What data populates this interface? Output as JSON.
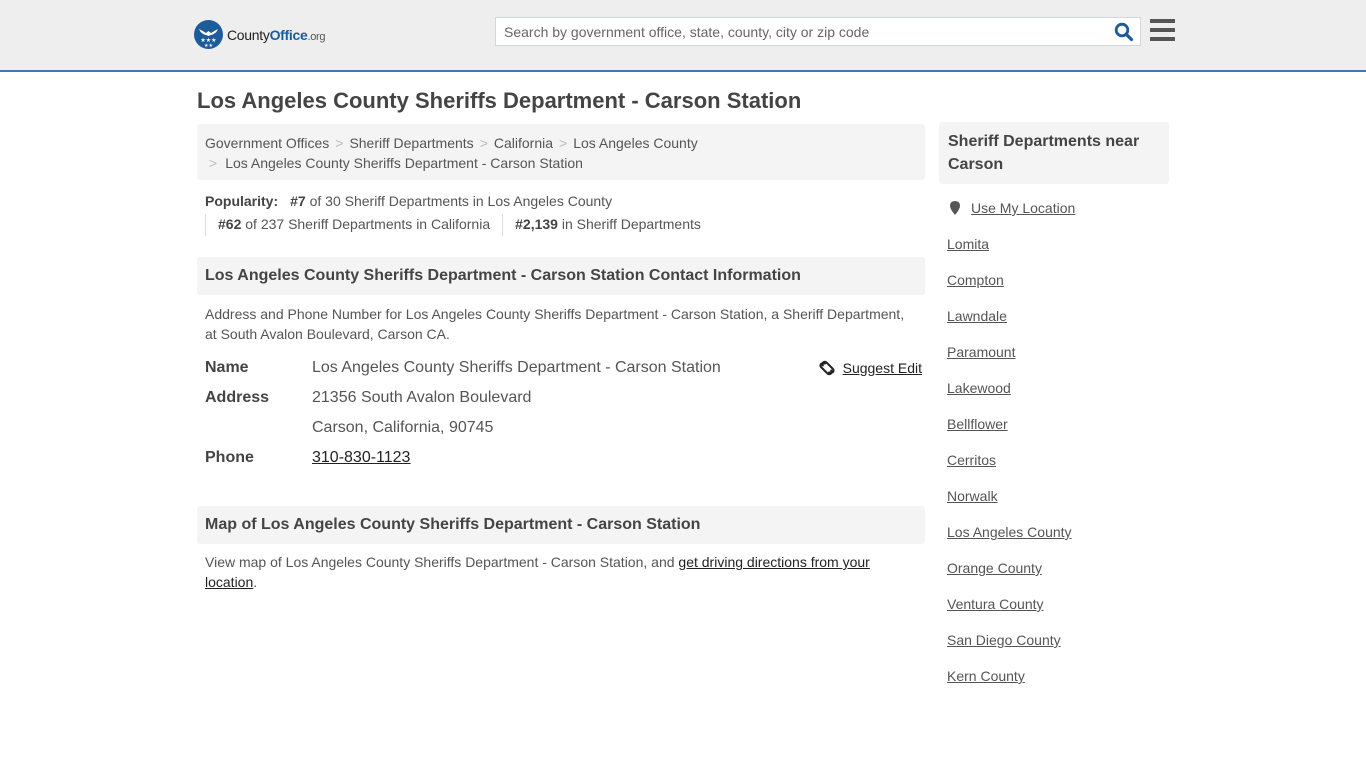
{
  "header": {
    "logo": {
      "county": "County",
      "office": "Office",
      "org": ".org",
      "icon": "eagle-stars-badge-icon"
    },
    "search": {
      "placeholder": "Search by government office, state, county, city or zip code",
      "value": "",
      "icon": "search-icon"
    },
    "menu_icon": "hamburger-menu-icon",
    "accent_color": "#1d5c9b",
    "border_color": "#3e78a8"
  },
  "page": {
    "title": "Los Angeles County Sheriffs Department - Carson Station"
  },
  "breadcrumb": [
    {
      "label": "Government Offices"
    },
    {
      "label": "Sheriff Departments"
    },
    {
      "label": "California"
    },
    {
      "label": "Los Angeles County"
    },
    {
      "label": "Los Angeles County Sheriffs Department - Carson Station"
    }
  ],
  "popularity": {
    "label": "Popularity:",
    "items": [
      {
        "rank": "#7",
        "text": " of 30 Sheriff Departments in Los Angeles County"
      },
      {
        "rank": "#62",
        "text": " of 237 Sheriff Departments in California"
      },
      {
        "rank": "#2,139",
        "text": " in Sheriff Departments"
      }
    ]
  },
  "contact": {
    "heading": "Los Angeles County Sheriffs Department - Carson Station Contact Information",
    "description": "Address and Phone Number for Los Angeles County Sheriffs Department - Carson Station, a Sheriff Department, at South Avalon Boulevard, Carson CA.",
    "suggest_edit": {
      "label": "Suggest Edit",
      "icon": "unlink-icon"
    },
    "fields": {
      "name": {
        "key": "Name",
        "value": "Los Angeles County Sheriffs Department - Carson Station"
      },
      "address": {
        "key": "Address",
        "line1": "21356 South Avalon Boulevard",
        "line2": "Carson, California, 90745"
      },
      "phone": {
        "key": "Phone",
        "value": "310-830-1123"
      }
    }
  },
  "map": {
    "heading": "Map of Los Angeles County Sheriffs Department - Carson Station",
    "text": "View map of Los Angeles County Sheriffs Department - Carson Station, and ",
    "link": "get driving directions from your location",
    "trailing": "."
  },
  "sidebar": {
    "heading": "Sheriff Departments near Carson",
    "use_location": {
      "label": "Use My Location",
      "icon": "map-pin-icon"
    },
    "links": [
      {
        "label": "Lomita"
      },
      {
        "label": "Compton"
      },
      {
        "label": "Lawndale"
      },
      {
        "label": "Paramount"
      },
      {
        "label": "Lakewood"
      },
      {
        "label": "Bellflower"
      },
      {
        "label": "Cerritos"
      },
      {
        "label": "Norwalk"
      },
      {
        "label": "Los Angeles County"
      },
      {
        "label": "Orange County"
      },
      {
        "label": "Ventura County"
      },
      {
        "label": "San Diego County"
      },
      {
        "label": "Kern County"
      }
    ]
  }
}
